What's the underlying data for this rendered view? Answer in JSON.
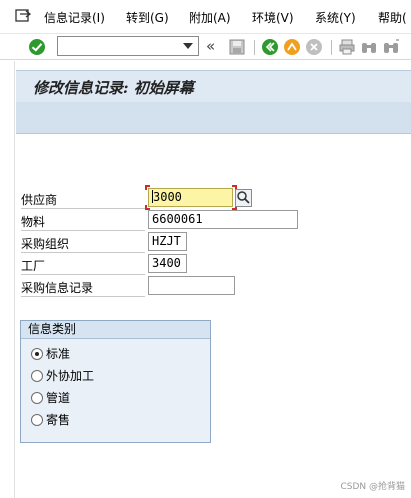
{
  "menu": {
    "items": [
      {
        "label": "信息记录(I)"
      },
      {
        "label": "转到(G)"
      },
      {
        "label": "附加(A)"
      },
      {
        "label": "环境(V)"
      },
      {
        "label": "系统(Y)"
      },
      {
        "label": "帮助("
      }
    ]
  },
  "toolbar": {
    "command_field_value": "",
    "chevron": "«"
  },
  "screen": {
    "title": "修改信息记录: 初始屏幕"
  },
  "form": {
    "vendor": {
      "label": "供应商",
      "value": "3000"
    },
    "material": {
      "label": "物料",
      "value": "6600061"
    },
    "purch_org": {
      "label": "采购组织",
      "value": "HZJT"
    },
    "plant": {
      "label": "工厂",
      "value": "3400"
    },
    "info_record": {
      "label": "采购信息记录",
      "value": ""
    }
  },
  "info_category": {
    "title": "信息类别",
    "options": [
      {
        "label": "标准",
        "selected": true
      },
      {
        "label": "外协加工",
        "selected": false
      },
      {
        "label": "管道",
        "selected": false
      },
      {
        "label": "寄售",
        "selected": false
      }
    ]
  },
  "watermark": "CSDN @抢背猫",
  "colors": {
    "focus_field": "#fdf5a6",
    "title_band": "#dfe9f3",
    "group_bg": "#e9f0f7",
    "enter_green": "#2e9a2e"
  }
}
